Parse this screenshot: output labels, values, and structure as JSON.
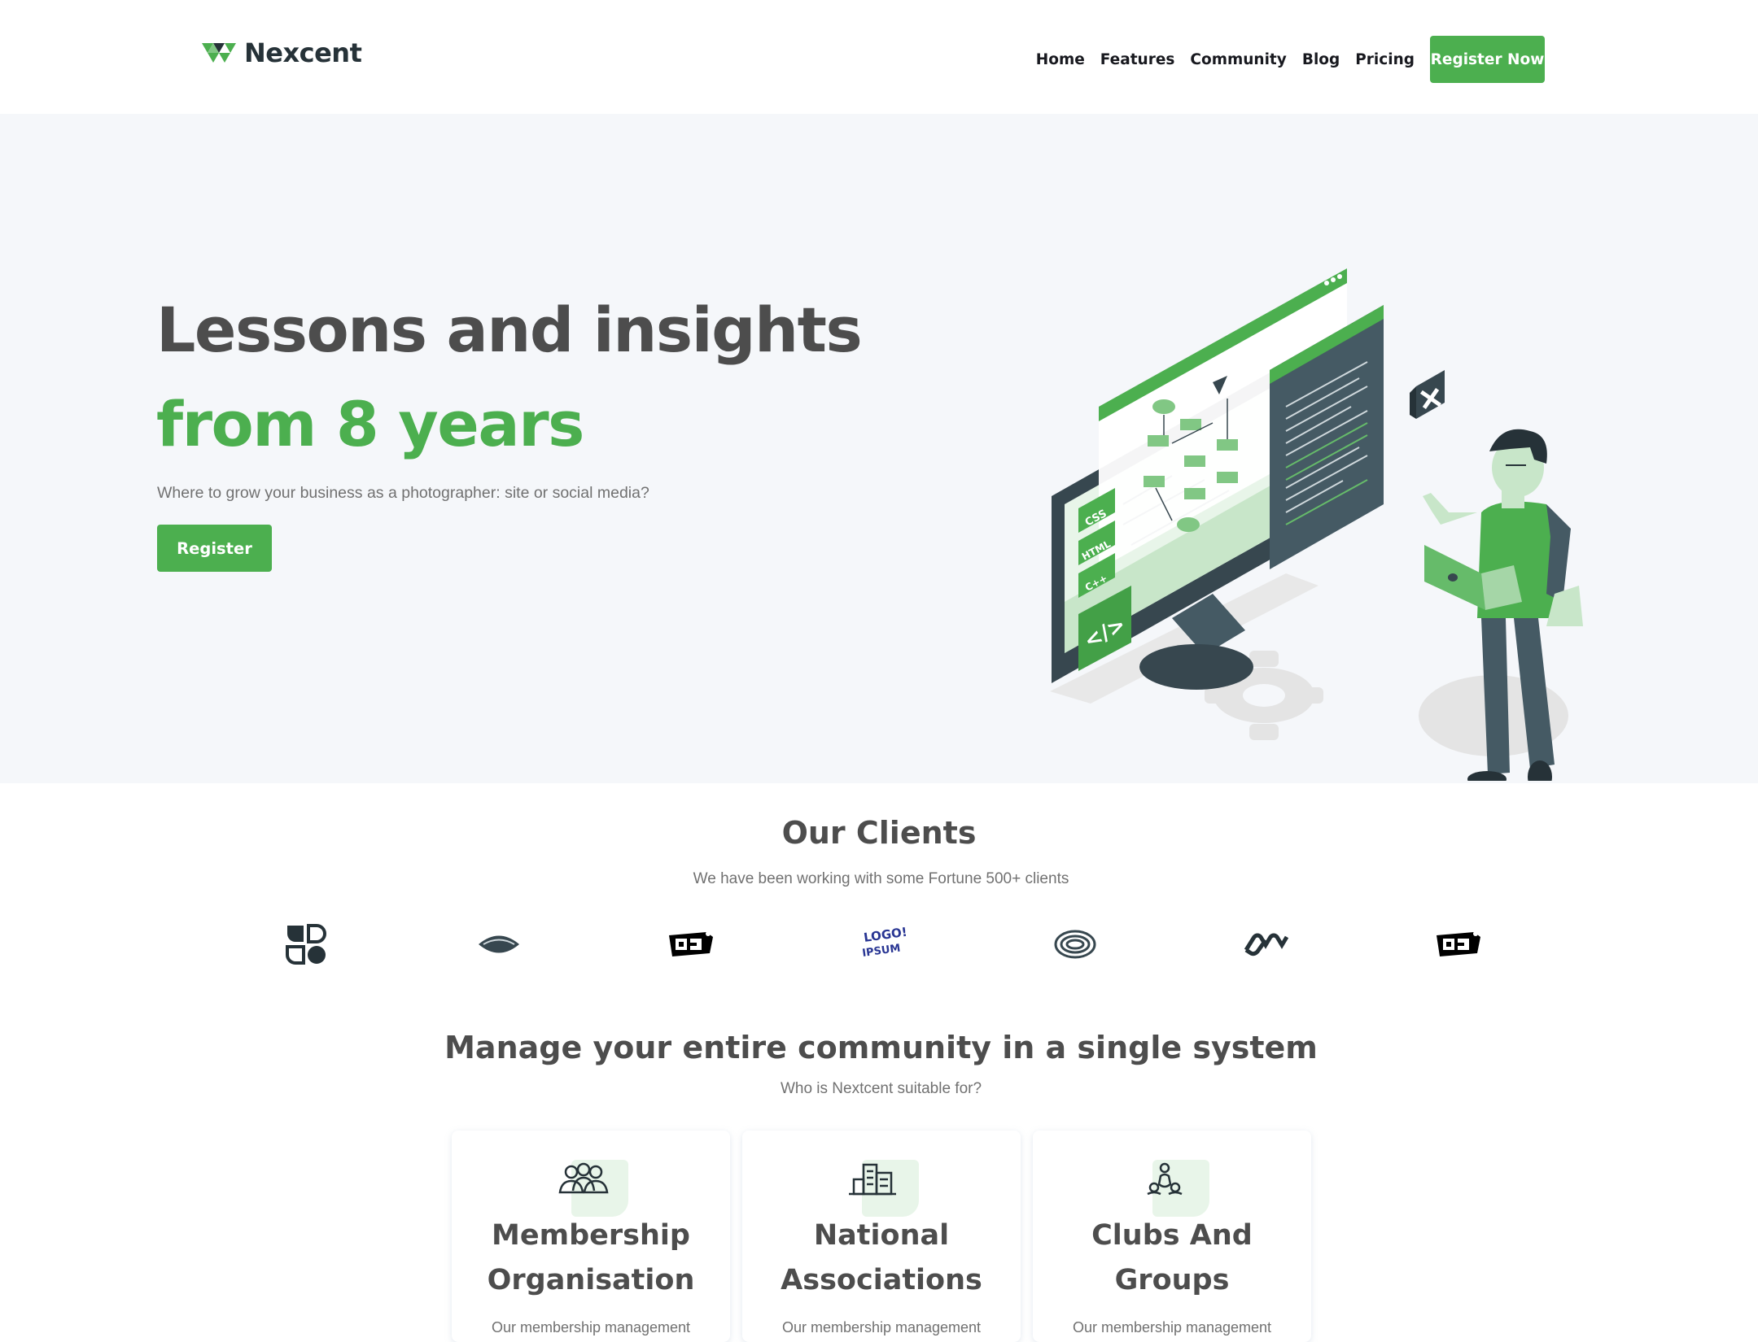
{
  "brand": {
    "name": "Nexcent",
    "accent": "#4caf4f",
    "dark": "#263238"
  },
  "nav": {
    "links": [
      "Home",
      "Features",
      "Community",
      "Blog",
      "Pricing"
    ],
    "cta": "Register Now"
  },
  "hero": {
    "title_plain": "Lessons and insights ",
    "title_accent": "from 8 years",
    "subtitle": "Where to grow your business as a photographer: site or social media?",
    "button": "Register",
    "illustration": {
      "badges": [
        "CSS",
        "HTML",
        "C++"
      ],
      "icons": [
        "code-icon",
        "gear-icon",
        "close-icon"
      ]
    }
  },
  "clients": {
    "title": "Our Clients",
    "subtitle": "We have been working with some Fortune 500+ clients",
    "logos": [
      {
        "name": "petals-logo"
      },
      {
        "name": "lens-logo"
      },
      {
        "name": "oj-logo"
      },
      {
        "name": "logoipsum-logo",
        "text_top": "LOGO!",
        "text_bottom": "IPSUM"
      },
      {
        "name": "rings-logo"
      },
      {
        "name": "chain-logo"
      },
      {
        "name": "oj-logo"
      }
    ]
  },
  "manage": {
    "title": "Manage your entire community in a single system",
    "subtitle": "Who is Nextcent suitable for?",
    "cards": [
      {
        "title_line1": "Membership",
        "title_line2": "Organisation",
        "text": "Our membership management",
        "icon": "people-icon"
      },
      {
        "title_line1": "National",
        "title_line2": "Associations",
        "text": "Our membership management",
        "icon": "building-icon"
      },
      {
        "title_line1": "Clubs And",
        "title_line2": "Groups",
        "text": "Our membership management",
        "icon": "hand-group-icon"
      }
    ]
  }
}
